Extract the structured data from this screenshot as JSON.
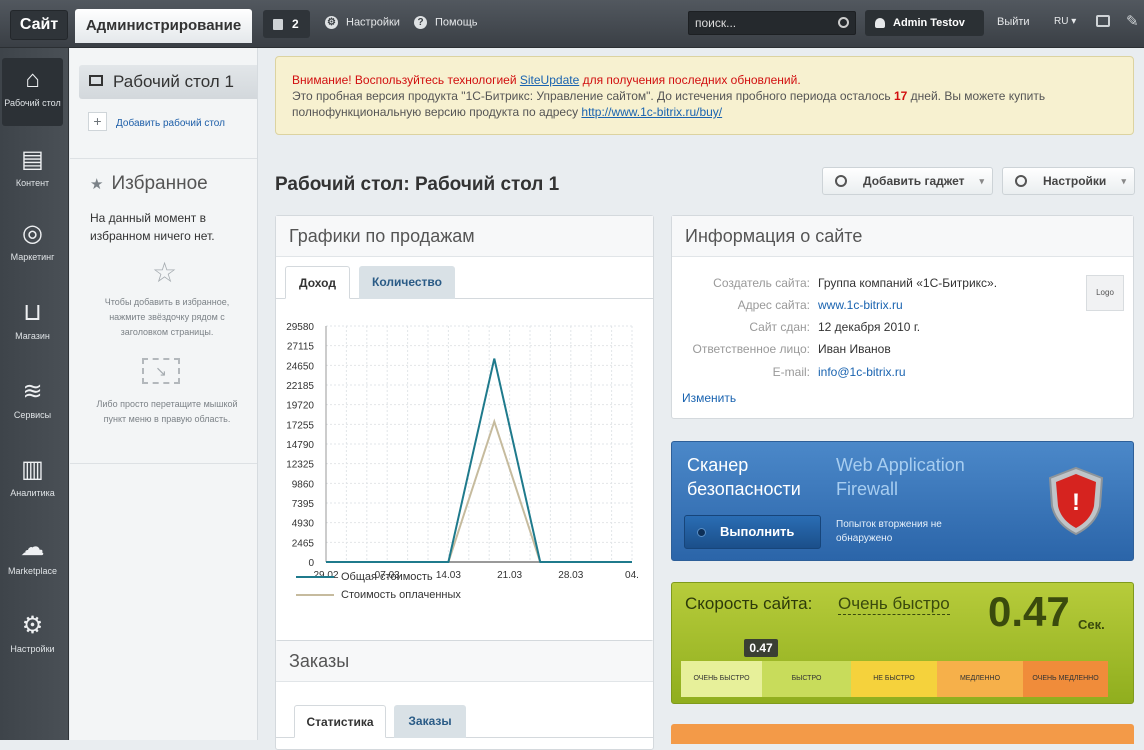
{
  "topbar": {
    "site": "Сайт",
    "admin": "Администрирование",
    "notifications": "2",
    "settings": "Настройки",
    "help": "Помощь",
    "search_placeholder": "поиск...",
    "user": "Admin Testov",
    "logout": "Выйти",
    "lang": "RU"
  },
  "nav": [
    {
      "label": "Рабочий стол",
      "icon": "home-icon"
    },
    {
      "label": "Контент",
      "icon": "document-icon"
    },
    {
      "label": "Маркетинг",
      "icon": "target-icon"
    },
    {
      "label": "Магазин",
      "icon": "basket-icon"
    },
    {
      "label": "Сервисы",
      "icon": "layers-icon"
    },
    {
      "label": "Аналитика",
      "icon": "bar-chart-icon"
    },
    {
      "label": "Marketplace",
      "icon": "cloud-download-icon"
    },
    {
      "label": "Настройки",
      "icon": "gear-icon"
    }
  ],
  "sidebar": {
    "desktop": "Рабочий стол 1",
    "add_desktop": "Добавить рабочий стол",
    "fav_title": "Избранное",
    "fav_empty": "На данный момент в избранном ничего нет.",
    "hint1": "Чтобы добавить в избранное, нажмите звёздочку рядом с заголовком страницы.",
    "hint2": "Либо просто перетащите мышкой пункт меню в правую область."
  },
  "notice": {
    "line1_a": "Внимание! Воспользуйтесь технологией ",
    "line1_link": "SiteUpdate",
    "line1_b": " для получения последних обновлений.",
    "line2_a": "Это пробная версия продукта \"1С-Битрикс: Управление сайтом\". До истечения пробного периода осталось ",
    "line2_days": "17",
    "line2_b": " дней. Вы можете купить полнофункциональную версию продукта по адресу ",
    "line2_link": "http://www.1c-bitrix.ru/buy/"
  },
  "page_title": "Рабочий стол: Рабочий стол 1",
  "buttons": {
    "add_gadget": "Добавить гаджет",
    "settings": "Настройки"
  },
  "sales": {
    "title": "Графики по продажам",
    "tab_income": "Доход",
    "tab_qty": "Количество",
    "legend_total": "Общая стоимость",
    "legend_paid": "Стоимость оплаченных"
  },
  "chart_data": {
    "type": "line",
    "x": [
      "29.02",
      "07.03",
      "14.03",
      "21.03",
      "28.03",
      "04."
    ],
    "ylim": [
      0,
      29580
    ],
    "yticks": [
      "29580",
      "27115",
      "24650",
      "22185",
      "19720",
      "17255",
      "14790",
      "12325",
      "9860",
      "7395",
      "4930",
      "2465",
      "0"
    ],
    "series": [
      {
        "name": "Общая стоимость",
        "color": "#1f7a8c",
        "points": [
          [
            0,
            0
          ],
          [
            2,
            0
          ],
          [
            2.75,
            25500
          ],
          [
            3.5,
            0
          ],
          [
            5,
            0
          ]
        ]
      },
      {
        "name": "Стоимость оплаченных",
        "color": "#c6bb9e",
        "points": [
          [
            0,
            0
          ],
          [
            2,
            0
          ],
          [
            2.75,
            17600
          ],
          [
            3.5,
            0
          ],
          [
            5,
            0
          ]
        ]
      }
    ]
  },
  "orders": {
    "title": "Заказы",
    "tab_stats": "Статистика",
    "tab_orders": "Заказы"
  },
  "siteinfo": {
    "title": "Информация о сайте",
    "rows": [
      {
        "k": "Создатель сайта:",
        "v": "Группа компаний «1С-Битрикс»."
      },
      {
        "k": "Адрес сайта:",
        "v": "www.1c-bitrix.ru"
      },
      {
        "k": "Сайт сдан:",
        "v": "12 декабря 2010 г."
      },
      {
        "k": "Ответственное лицо:",
        "v": "Иван Иванов"
      },
      {
        "k": "E-mail:",
        "v": "info@1c-bitrix.ru"
      }
    ],
    "logo": "Logo",
    "edit": "Изменить"
  },
  "scanner": {
    "title": "Сканер безопасности",
    "waf": "Web Application Firewall",
    "run": "Выполнить",
    "status": "Попыток вторжения не обнаружено"
  },
  "speed": {
    "title": "Скорость сайта:",
    "rating": "Очень быстро",
    "value": "0.47",
    "unit": "Сек.",
    "marker": "0.47",
    "segments": [
      "ОЧЕНЬ БЫСТРО",
      "БЫСТРО",
      "НЕ БЫСТРО",
      "МЕДЛЕННО",
      "ОЧЕНЬ МЕДЛЕННО"
    ]
  }
}
